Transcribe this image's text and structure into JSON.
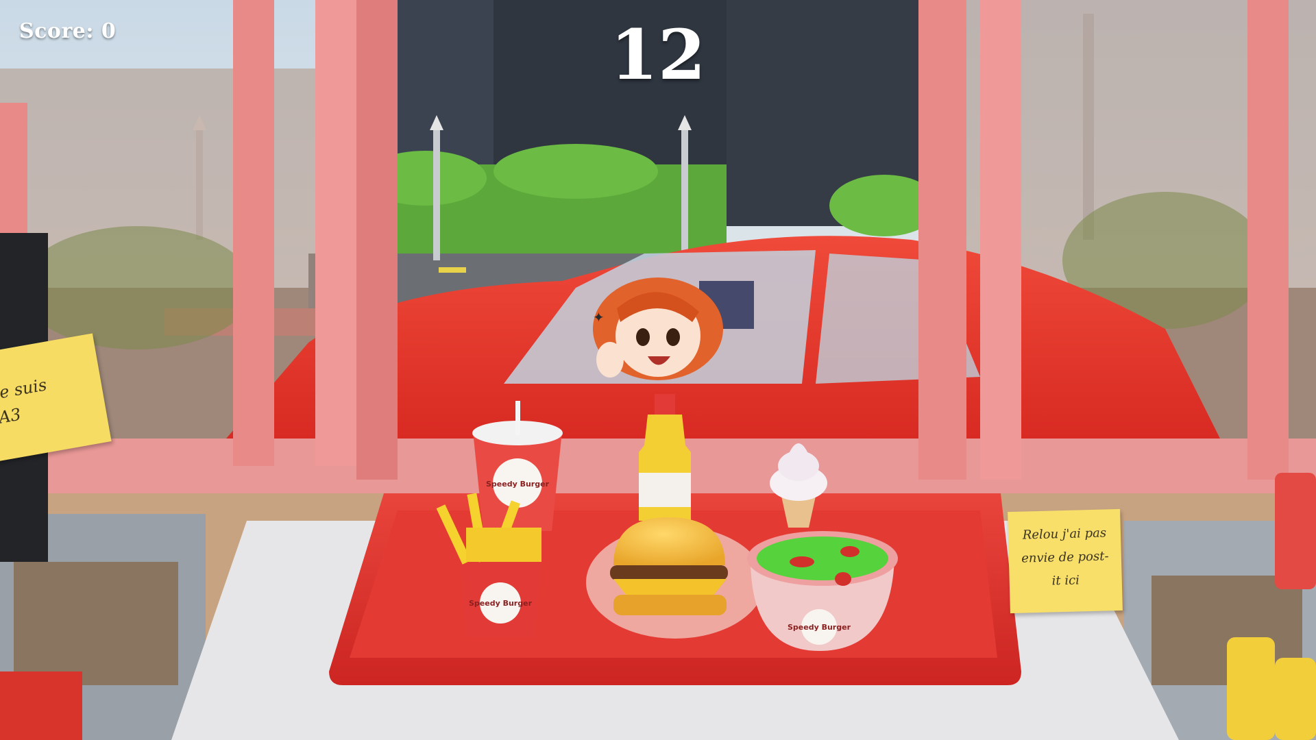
{
  "hud": {
    "score_text": "Score: 0",
    "timer_text": "12"
  },
  "notes": {
    "left_lines": [
      "je suis",
      "A3"
    ],
    "right_lines": [
      "Relou j'ai pas",
      "envie de post-",
      "it ici"
    ]
  },
  "branding": {
    "logo_text": "Speedy Burger"
  },
  "colors": {
    "window_frame": "#e88a88",
    "car": "#e8362e",
    "tray": "#e23230",
    "counter": "#e4e4e6",
    "postit": "#f6dc63"
  },
  "icons": {
    "burger": "burger-icon",
    "fries": "fries-icon",
    "drink": "soda-cup-icon",
    "bottle": "juice-bottle-icon",
    "ice_cream": "ice-cream-cone-icon",
    "salad": "salad-bowl-icon"
  }
}
